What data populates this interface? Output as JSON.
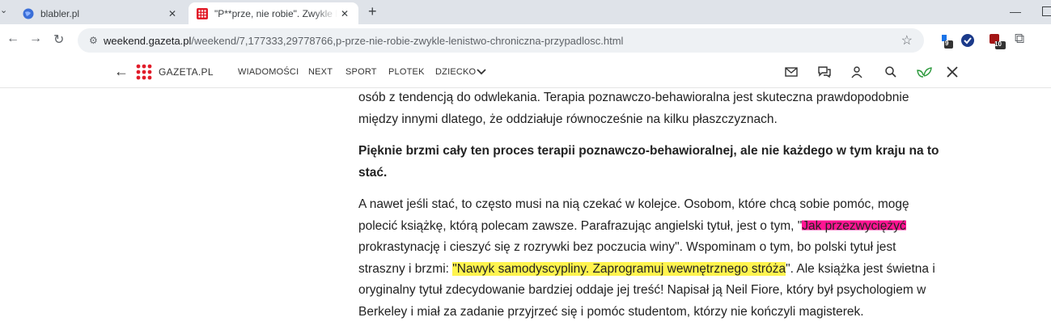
{
  "browser": {
    "tabs": [
      {
        "title": "blabler.pl",
        "active": false
      },
      {
        "title": "\"P**prze, nie robie\". Zwykle leni",
        "active": true
      }
    ],
    "url_host": "weekend.gazeta.pl",
    "url_path": "/weekend/7,177333,29778766,p-prze-nie-robie-zwykle-lenistwo-chroniczna-przypadlosc.html",
    "extension_badges": [
      "9",
      "10"
    ]
  },
  "site": {
    "logo": "GAZETA.PL",
    "nav": [
      "WIADOMOŚCI",
      "NEXT",
      "SPORT",
      "PLOTEK",
      "DZIECKO"
    ],
    "icons": [
      "mail-icon",
      "comments-icon",
      "user-icon",
      "search-icon",
      "leaf-icon",
      "close-icon"
    ]
  },
  "article": {
    "p1": [
      "osób z tendencją do odwlekania. Terapia poznawczo-behawioralna jest skuteczna prawdopodobnie",
      "między innymi dlatego, że oddziałuje równocześnie na kilku płaszczyznach."
    ],
    "p2": [
      "Pięknie brzmi cały ten proces terapii poznawczo-behawioralnej, ale nie każdego w tym kraju na to",
      "stać."
    ],
    "p3": {
      "l1": "A nawet jeśli stać, to często musi na nią czekać w kolejce. Osobom, które chcą sobie pomóc, mogę",
      "l2_pre": "polecić książkę, którą polecam zawsze. Parafrazując angielski tytuł, jest o tym, \"",
      "l2_hl": "Jak przezwyciężyć",
      "l3": "prokrastynację i cieszyć się z rozrywki bez poczucia winy\". Wspominam o tym, bo polski tytuł jest",
      "l4_pre": "straszny i brzmi: ",
      "l4_hl": "\"Nawyk samodyscypliny. Zaprogramuj wewnętrznego stróża",
      "l4_post": "\". Ale książka jest świetna i",
      "l5": "oryginalny tytuł zdecydowanie bardziej oddaje jej treść! Napisał ją Neil Fiore, który był psychologiem w",
      "l6": "Berkeley i miał za zadanie przyjrzeć się i pomóc studentom, którzy nie kończyli magisterek."
    }
  },
  "colors": {
    "highlight_yellow": "#fff44f",
    "highlight_pink": "#ff1493",
    "logo_red": "#e11d2a"
  }
}
